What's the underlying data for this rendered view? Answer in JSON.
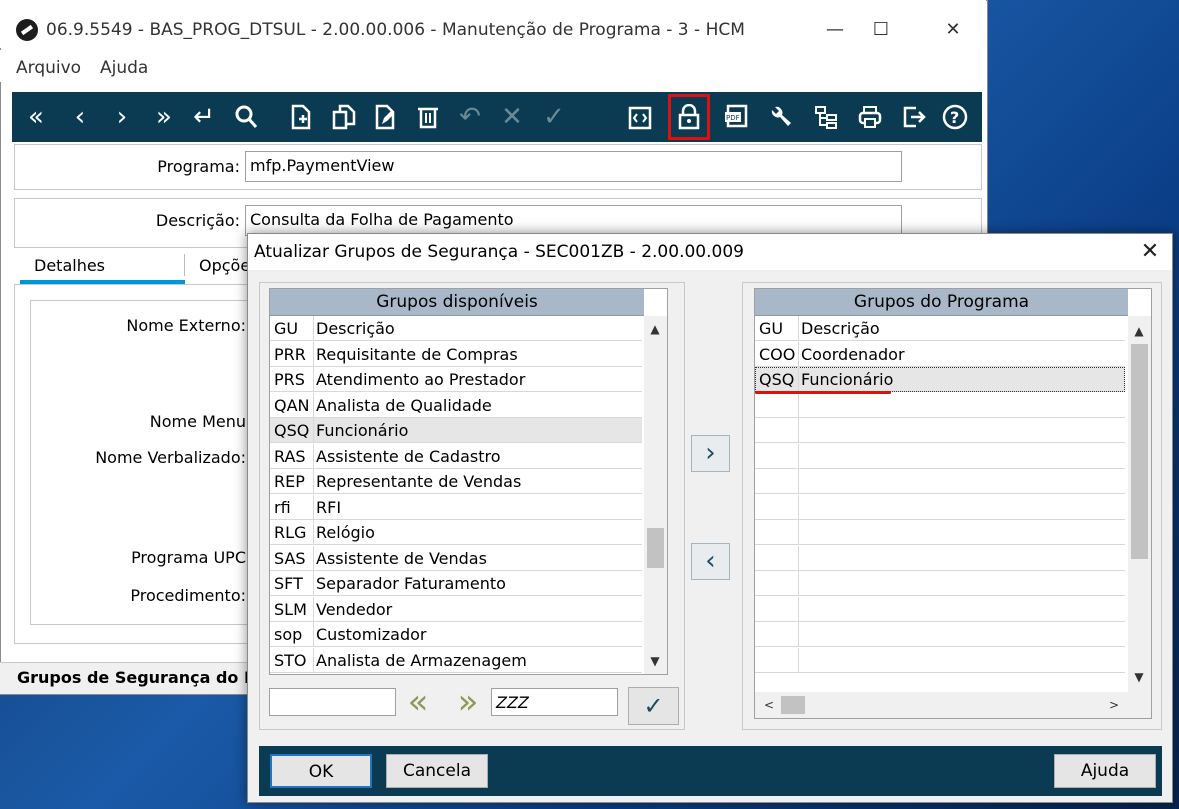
{
  "main_window": {
    "title": "06.9.5549 - BAS_PROG_DTSUL - 2.00.00.006 - Manutenção de Programa - 3 - HCM",
    "controls": {
      "minimize": "—",
      "maximize": "☐",
      "close": "✕"
    },
    "menu": [
      "Arquivo",
      "Ajuda"
    ],
    "toolbar": [
      "first-icon",
      "previous-icon",
      "next-icon",
      "last-icon",
      "goto-icon",
      "search-icon",
      "new-icon",
      "copy-icon",
      "edit-icon",
      "delete-icon",
      "undo-icon",
      "cancel-icon",
      "confirm-icon",
      "code-icon",
      "lock-icon",
      "pdf-icon",
      "wrench-icon",
      "hierarchy-icon",
      "print-icon",
      "exit-icon",
      "help-icon"
    ],
    "fields": {
      "programa_label": "Programa:",
      "programa_value": "mfp.PaymentView",
      "descricao_label": "Descrição:",
      "descricao_value": "Consulta da Folha de Pagamento"
    },
    "tabs": [
      "Detalhes",
      "Opçõe"
    ],
    "detail_labels": {
      "nome_externo": "Nome Externo:",
      "nome_menu": "Nome Menu",
      "nome_verbalizado": "Nome Verbalizado:",
      "programa_upc": "Programa UPC",
      "procedimento": "Procedimento:"
    },
    "status_text": "Grupos de Segurança do P"
  },
  "dialog": {
    "title": "Atualizar Grupos de Segurança - SEC001ZB - 2.00.00.009",
    "close": "✕",
    "available": {
      "header": "Grupos disponíveis",
      "rows": [
        {
          "code": "GU",
          "desc": "Descrição"
        },
        {
          "code": "PRR",
          "desc": "Requisitante de Compras"
        },
        {
          "code": "PRS",
          "desc": "Atendimento ao Prestador"
        },
        {
          "code": "QAN",
          "desc": "Analista de Qualidade"
        },
        {
          "code": "QSQ",
          "desc": "Funcionário"
        },
        {
          "code": "RAS",
          "desc": "Assistente de Cadastro"
        },
        {
          "code": "REP",
          "desc": "Representante de Vendas"
        },
        {
          "code": "rfi",
          "desc": "RFI"
        },
        {
          "code": "RLG",
          "desc": "Relógio"
        },
        {
          "code": "SAS",
          "desc": "Assistente de Vendas"
        },
        {
          "code": "SFT",
          "desc": "Separador Faturamento"
        },
        {
          "code": "SLM",
          "desc": "Vendedor"
        },
        {
          "code": "sop",
          "desc": "Customizador"
        },
        {
          "code": "STO",
          "desc": "Analista de Armazenagem"
        }
      ],
      "filter_from": "",
      "filter_to": "ZZZ"
    },
    "assigned": {
      "header": "Grupos do Programa",
      "rows": [
        {
          "code": "GU",
          "desc": "Descrição"
        },
        {
          "code": "COO",
          "desc": "Coordenador"
        },
        {
          "code": "QSQ",
          "desc": "Funcionário"
        }
      ]
    },
    "buttons": {
      "ok": "OK",
      "cancel": "Cancela",
      "help": "Ajuda"
    },
    "glyphs": {
      "add": "›",
      "remove": "‹",
      "prev": "«",
      "next": "»",
      "confirm": "✓",
      "up": "▲",
      "down": "▼",
      "left": "<",
      "right": ">"
    }
  },
  "colors": {
    "toolbar": "#0a3b52",
    "tab_accent": "#0096d6",
    "highlight": "#e01010",
    "list_header": "#a8b8c8"
  }
}
